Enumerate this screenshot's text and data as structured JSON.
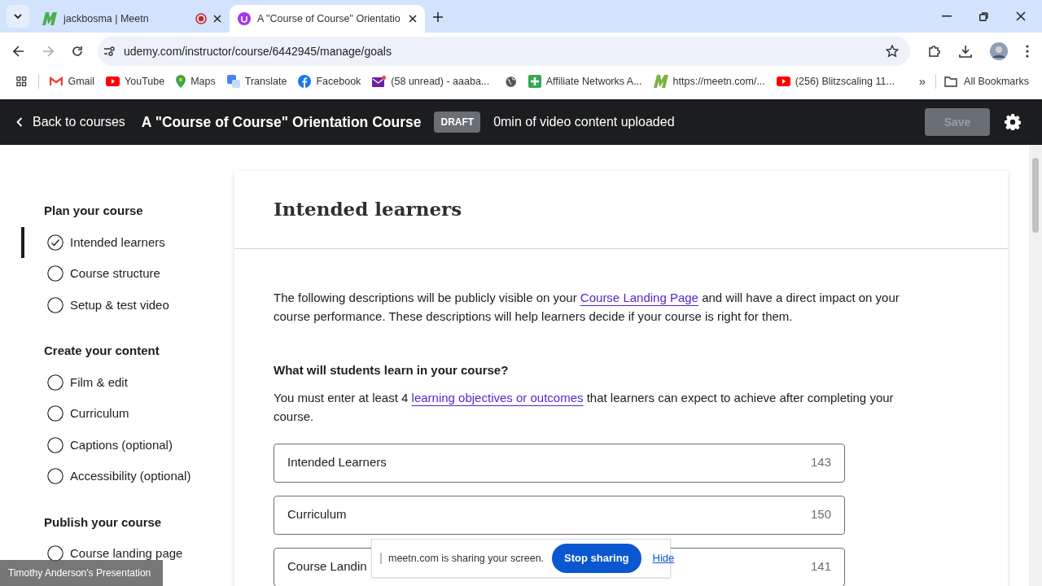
{
  "browser": {
    "tabs": [
      {
        "title": "jackbosma | Meetn",
        "selected": false,
        "recording": true
      },
      {
        "title": "A \"Course of Course\" Orientatio",
        "selected": true,
        "recording": false
      }
    ],
    "url": "udemy.com/instructor/course/6442945/manage/goals",
    "bookmarks": [
      {
        "kind": "gmail",
        "label": "Gmail"
      },
      {
        "kind": "youtube",
        "label": "YouTube"
      },
      {
        "kind": "maps",
        "label": "Maps"
      },
      {
        "kind": "translate",
        "label": "Translate"
      },
      {
        "kind": "facebook",
        "label": "Facebook"
      },
      {
        "kind": "mail",
        "label": "(58 unread) - aaaba..."
      },
      {
        "kind": "globe"
      },
      {
        "kind": "sheet",
        "label": "Affiliate Networks A..."
      },
      {
        "kind": "meetn",
        "label": "https://meetn.com/..."
      },
      {
        "kind": "youtube",
        "label": "(256) Blitzscaling 11..."
      }
    ],
    "more": "»",
    "all_bookmarks": "All Bookmarks"
  },
  "header": {
    "back": "Back to courses",
    "title": "A \"Course of Course\" Orientation Course",
    "badge": "DRAFT",
    "status": "0min of video content uploaded",
    "save": "Save",
    "save_disabled": true
  },
  "sidebar": [
    {
      "heading": "Plan your course",
      "items": [
        {
          "label": "Intended learners",
          "checked": true,
          "selected": true
        },
        {
          "label": "Course structure",
          "checked": false,
          "selected": false
        },
        {
          "label": "Setup & test video",
          "checked": false,
          "selected": false
        }
      ]
    },
    {
      "heading": "Create your content",
      "items": [
        {
          "label": "Film & edit",
          "checked": false,
          "selected": false
        },
        {
          "label": "Curriculum",
          "checked": false,
          "selected": false
        },
        {
          "label": "Captions (optional)",
          "checked": false,
          "selected": false
        },
        {
          "label": "Accessibility (optional)",
          "checked": false,
          "selected": false
        }
      ]
    },
    {
      "heading": "Publish your course",
      "items": [
        {
          "label": "Course landing page",
          "checked": false,
          "selected": false
        }
      ]
    }
  ],
  "main": {
    "title": "Intended learners",
    "intro": [
      "The following descriptions will be publicly visible on your ",
      "Course Landing Page",
      " and will have a direct impact on your course performance. These descriptions will help learners decide if your course is right for them."
    ],
    "question": "What will students learn in your course?",
    "help": [
      "You must enter at least 4 ",
      "learning objectives or outcomes",
      " that learners can expect to achieve after completing your course."
    ],
    "objectives": [
      {
        "value": "Intended Learners",
        "count": "143"
      },
      {
        "value": "Curriculum",
        "count": "150"
      },
      {
        "value": "Course Landin",
        "count": "141"
      }
    ]
  },
  "share_bar": {
    "message": "meetn.com is sharing your screen.",
    "stop": "Stop sharing",
    "hide": "Hide"
  },
  "presenter_label": "Timothy Anderson's Presentation"
}
